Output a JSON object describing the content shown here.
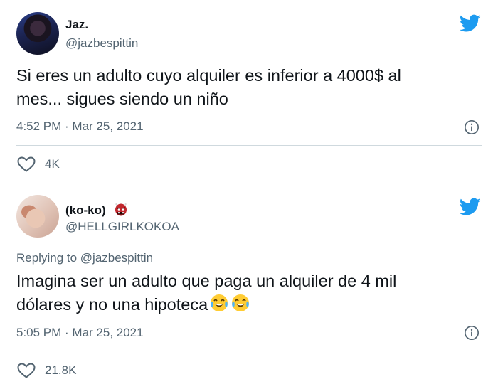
{
  "tweets": [
    {
      "name": "Jaz.",
      "handle": "@jazbespittin",
      "text_line1": "Si eres un adulto cuyo alquiler es inferior a 4000$ al",
      "text_line2": "mes... sigues siendo un niño",
      "timestamp": "4:52 PM · Mar 25, 2021",
      "likes": "4K"
    },
    {
      "name": "(ko-ko)",
      "name_emoji": "ogre-emoji",
      "handle": "@HELLGIRLKOKOA",
      "replying_prefix": "Replying to ",
      "replying_to": "@jazbespittin",
      "text_line1": "Imagina ser un adulto que paga un alquiler de 4 mil",
      "text_line2": "dólares y no una hipoteca",
      "text_emojis": [
        "tears-of-joy-emoji",
        "tears-of-joy-emoji"
      ],
      "timestamp": "5:05 PM · Mar 25, 2021",
      "likes": "21.8K"
    }
  ],
  "colors": {
    "twitter_blue": "#1d9bf0",
    "secondary_text": "#536471",
    "divider": "#cfd9de"
  }
}
